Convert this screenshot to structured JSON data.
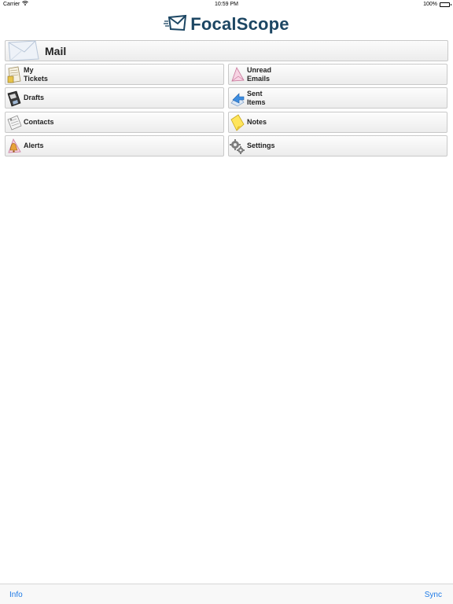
{
  "status_bar": {
    "carrier": "Carrier",
    "time": "10:59 PM",
    "battery": "100%",
    "battery_level": 1.0
  },
  "logo": {
    "text": "FocalScope",
    "icon": "envelope-logo-icon",
    "color": "#1c4663"
  },
  "mail_header": {
    "title": "Mail",
    "icon": "mail-envelope-icon"
  },
  "tiles": [
    {
      "label": "My\nTickets",
      "icon": "tickets-icon"
    },
    {
      "label": "Unread\nEmails",
      "icon": "unread-envelope-icon"
    },
    {
      "label": "Drafts",
      "icon": "floppy-disk-icon"
    },
    {
      "label": "Sent\nItems",
      "icon": "sent-arrow-icon"
    },
    {
      "label": "Contacts",
      "icon": "contacts-card-icon"
    },
    {
      "label": "Notes",
      "icon": "sticky-note-icon"
    },
    {
      "label": "Alerts",
      "icon": "alert-bell-icon"
    },
    {
      "label": "Settings",
      "icon": "gear-icon"
    }
  ],
  "toolbar": {
    "left_label": "Info",
    "right_label": "Sync",
    "accent": "#1e7ae6"
  }
}
